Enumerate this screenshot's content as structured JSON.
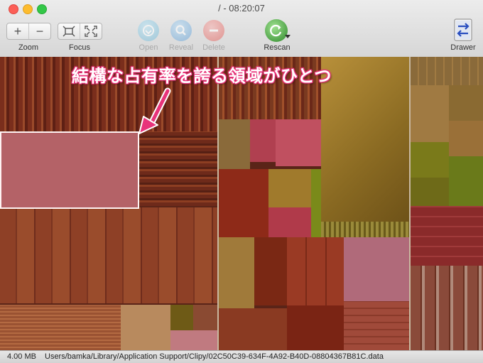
{
  "window": {
    "title": "/ - 08:20:07"
  },
  "toolbar": {
    "zoom": {
      "label": "Zoom",
      "plus": "+",
      "minus": "−"
    },
    "focus": {
      "label": "Focus"
    },
    "open": {
      "label": "Open",
      "enabled": false
    },
    "reveal": {
      "label": "Reveal",
      "enabled": false
    },
    "delete": {
      "label": "Delete",
      "enabled": false
    },
    "rescan": {
      "label": "Rescan"
    },
    "drawer": {
      "label": "Drawer"
    }
  },
  "annotation": {
    "text": "結構な占有率を誇る領域がひとつ",
    "color": "#e8337a"
  },
  "status": {
    "size": "4.00 MB",
    "path": "Users/bamka/Library/Application Support/Clipy/02C50C39-634F-4A92-B40D-08804367B81C.data"
  },
  "colors": {
    "accent_pink": "#e8337a",
    "treemap_dark": "#5a2418",
    "treemap_gold": "#a07a2c"
  }
}
